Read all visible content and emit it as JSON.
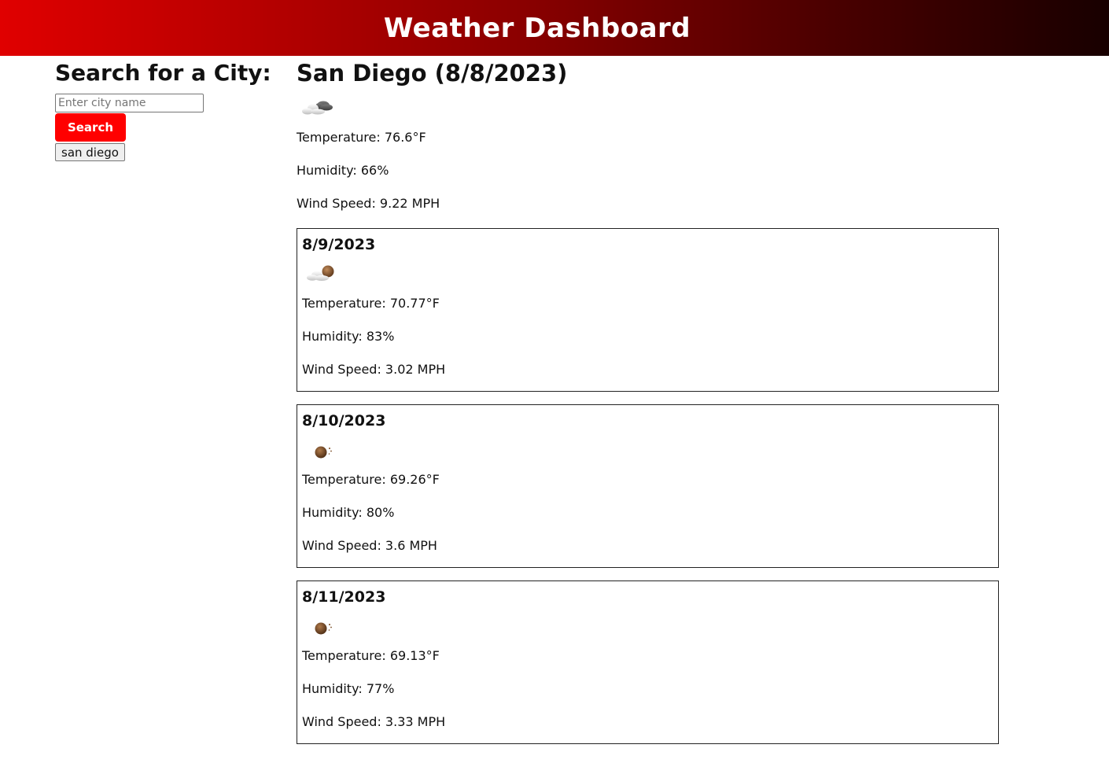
{
  "header": {
    "title": "Weather Dashboard"
  },
  "sidebar": {
    "heading": "Search for a City:",
    "input_placeholder": "Enter city name",
    "input_value": "",
    "search_label": "Search",
    "history": [
      "san diego"
    ]
  },
  "current": {
    "heading": "San Diego (8/8/2023)",
    "icon": "broken-clouds-icon",
    "temperature": "Temperature: 76.6°F",
    "humidity": "Humidity: 66%",
    "wind": "Wind Speed: 9.22 MPH"
  },
  "forecast": [
    {
      "date": "8/9/2023",
      "icon": "few-clouds-night-icon",
      "temperature": "Temperature: 70.77°F",
      "humidity": "Humidity: 83%",
      "wind": "Wind Speed: 3.02 MPH"
    },
    {
      "date": "8/10/2023",
      "icon": "clear-sky-night-icon",
      "temperature": "Temperature: 69.26°F",
      "humidity": "Humidity: 80%",
      "wind": "Wind Speed: 3.6 MPH"
    },
    {
      "date": "8/11/2023",
      "icon": "clear-sky-night-icon",
      "temperature": "Temperature: 69.13°F",
      "humidity": "Humidity: 77%",
      "wind": "Wind Speed: 3.33 MPH"
    }
  ],
  "colors": {
    "header_start": "#e00000",
    "header_end": "#180000",
    "search_button": "#ff0000"
  }
}
